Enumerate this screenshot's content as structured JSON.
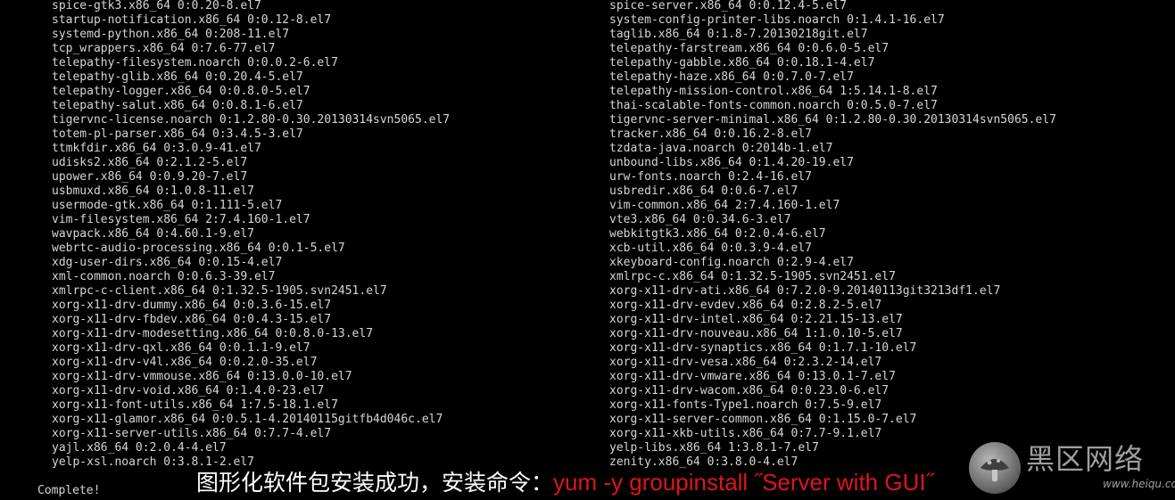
{
  "terminal": {
    "left_column": [
      "spice-gtk3.x86_64 0:0.20-8.el7",
      "startup-notification.x86_64 0:0.12-8.el7",
      "systemd-python.x86_64 0:208-11.el7",
      "tcp_wrappers.x86_64 0:7.6-77.el7",
      "telepathy-filesystem.noarch 0:0.0.2-6.el7",
      "telepathy-glib.x86_64 0:0.20.4-5.el7",
      "telepathy-logger.x86_64 0:0.8.0-5.el7",
      "telepathy-salut.x86_64 0:0.8.1-6.el7",
      "tigervnc-license.noarch 0:1.2.80-0.30.20130314svn5065.el7",
      "totem-pl-parser.x86_64 0:3.4.5-3.el7",
      "ttmkfdir.x86_64 0:3.0.9-41.el7",
      "udisks2.x86_64 0:2.1.2-5.el7",
      "upower.x86_64 0:0.9.20-7.el7",
      "usbmuxd.x86_64 0:1.0.8-11.el7",
      "usermode-gtk.x86_64 0:1.111-5.el7",
      "vim-filesystem.x86_64 2:7.4.160-1.el7",
      "wavpack.x86_64 0:4.60.1-9.el7",
      "webrtc-audio-processing.x86_64 0:0.1-5.el7",
      "xdg-user-dirs.x86_64 0:0.15-4.el7",
      "xml-common.noarch 0:0.6.3-39.el7",
      "xmlrpc-c-client.x86_64 0:1.32.5-1905.svn2451.el7",
      "xorg-x11-drv-dummy.x86_64 0:0.3.6-15.el7",
      "xorg-x11-drv-fbdev.x86_64 0:0.4.3-15.el7",
      "xorg-x11-drv-modesetting.x86_64 0:0.8.0-13.el7",
      "xorg-x11-drv-qxl.x86_64 0:0.1.1-9.el7",
      "xorg-x11-drv-v4l.x86_64 0:0.2.0-35.el7",
      "xorg-x11-drv-vmmouse.x86_64 0:13.0.0-10.el7",
      "xorg-x11-drv-void.x86_64 0:1.4.0-23.el7",
      "xorg-x11-font-utils.x86_64 1:7.5-18.1.el7",
      "xorg-x11-glamor.x86_64 0:0.5.1-4.20140115gitfb4d046c.el7",
      "xorg-x11-server-utils.x86_64 0:7.7-4.el7",
      "yajl.x86_64 0:2.0.4-4.el7",
      "yelp-xsl.noarch 0:3.8.1-2.el7"
    ],
    "right_column": [
      "spice-server.x86_64 0:0.12.4-5.el7",
      "system-config-printer-libs.noarch 0:1.4.1-16.el7",
      "taglib.x86_64 0:1.8-7.20130218git.el7",
      "telepathy-farstream.x86_64 0:0.6.0-5.el7",
      "telepathy-gabble.x86_64 0:0.18.1-4.el7",
      "telepathy-haze.x86_64 0:0.7.0-7.el7",
      "telepathy-mission-control.x86_64 1:5.14.1-8.el7",
      "thai-scalable-fonts-common.noarch 0:0.5.0-7.el7",
      "tigervnc-server-minimal.x86_64 0:1.2.80-0.30.20130314svn5065.el7",
      "tracker.x86_64 0:0.16.2-8.el7",
      "tzdata-java.noarch 0:2014b-1.el7",
      "unbound-libs.x86_64 0:1.4.20-19.el7",
      "urw-fonts.noarch 0:2.4-16.el7",
      "usbredir.x86_64 0:0.6-7.el7",
      "vim-common.x86_64 2:7.4.160-1.el7",
      "vte3.x86_64 0:0.34.6-3.el7",
      "webkitgtk3.x86_64 0:2.0.4-6.el7",
      "xcb-util.x86_64 0:0.3.9-4.el7",
      "xkeyboard-config.noarch 0:2.9-4.el7",
      "xmlrpc-c.x86_64 0:1.32.5-1905.svn2451.el7",
      "xorg-x11-drv-ati.x86_64 0:7.2.0-9.20140113git3213df1.el7",
      "xorg-x11-drv-evdev.x86_64 0:2.8.2-5.el7",
      "xorg-x11-drv-intel.x86_64 0:2.21.15-13.el7",
      "xorg-x11-drv-nouveau.x86_64 1:1.0.10-5.el7",
      "xorg-x11-drv-synaptics.x86_64 0:1.7.1-10.el7",
      "xorg-x11-drv-vesa.x86_64 0:2.3.2-14.el7",
      "xorg-x11-drv-vmware.x86_64 0:13.0.1-7.el7",
      "xorg-x11-drv-wacom.x86_64 0:0.23.0-6.el7",
      "xorg-x11-fonts-Type1.noarch 0:7.5-9.el7",
      "xorg-x11-server-common.x86_64 0:1.15.0-7.el7",
      "xorg-x11-xkb-utils.x86_64 0:7.7-9.1.el7",
      "yelp-libs.x86_64 1:3.8.1-7.el7",
      "zenity.x86_64 0:3.8.0-4.el7"
    ],
    "status_line": "Complete!"
  },
  "caption": {
    "chinese": "图形化软件包安装成功，安装命令：",
    "command": "yum  -y  groupinstall ˝Server with GUI˝"
  },
  "watermark": {
    "title": "黑区网络",
    "url": "www.heiqu.com",
    "logo_icon": "mushroom-logo-icon"
  },
  "colors": {
    "background": "#000000",
    "terminal_text": "#d6d6d6",
    "caption_text": "#ffffff",
    "command_text": "#e0141c",
    "watermark": "#bdbdbd"
  }
}
